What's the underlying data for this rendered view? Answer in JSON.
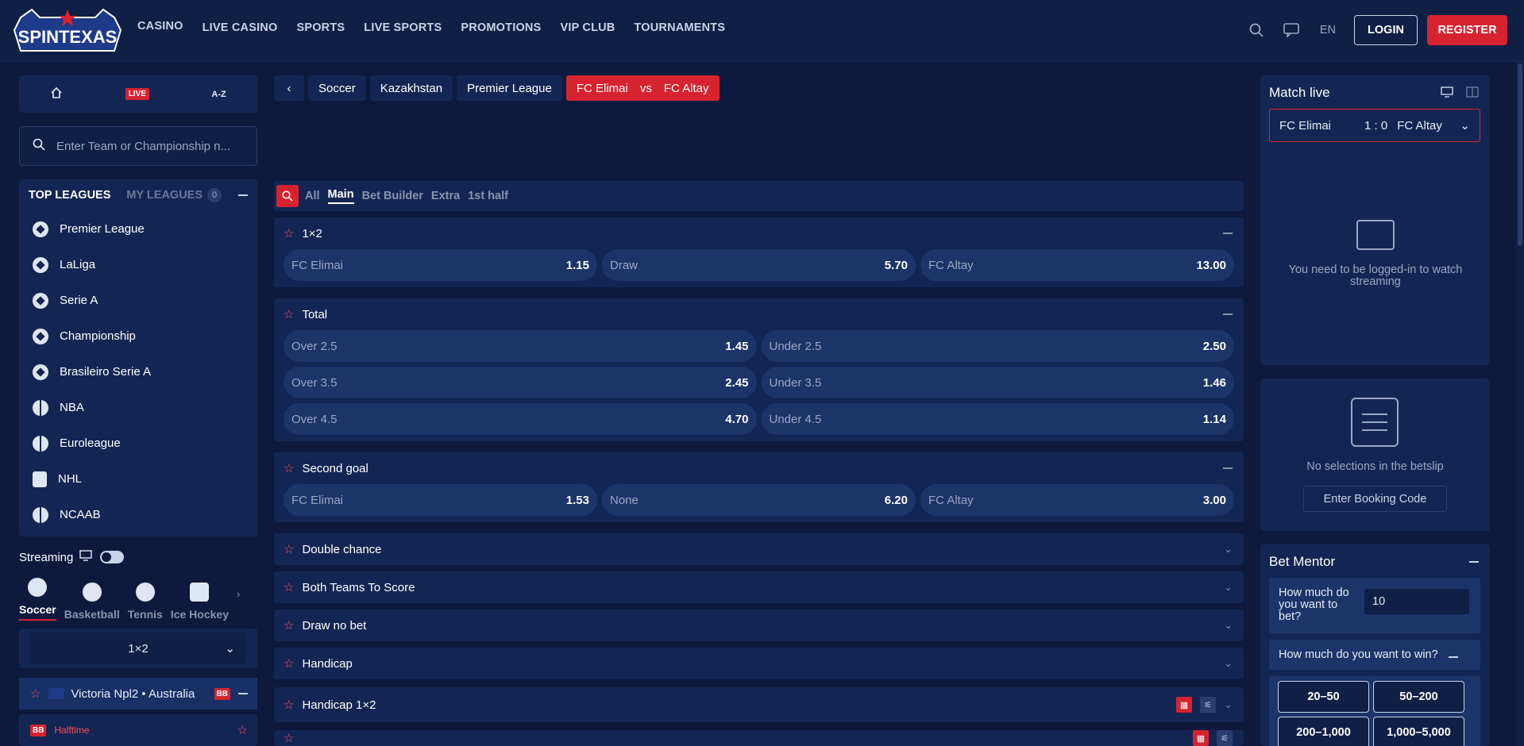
{
  "brand": {
    "logo_text": "SPINTEXAS",
    "accent": "#d6232f",
    "bg": "#0d1a3d"
  },
  "nav": [
    "CASINO",
    "LIVE CASINO",
    "SPORTS",
    "LIVE SPORTS",
    "PROMOTIONS",
    "VIP CLUB",
    "TOURNAMENTS"
  ],
  "header": {
    "lang": "EN",
    "login": "LOGIN",
    "register": "REGISTER"
  },
  "left": {
    "tabs": {
      "live": "LIVE",
      "az": "A-Z"
    },
    "search_placeholder": "Enter Team or Championship n...",
    "top_leagues": "TOP LEAGUES",
    "my_leagues": "MY LEAGUES",
    "my_leagues_count": "0",
    "leagues": [
      "Premier League",
      "LaLiga",
      "Serie A",
      "Championship",
      "Brasileiro Serie A",
      "NBA",
      "Euroleague",
      "NHL",
      "NCAAB"
    ],
    "streaming": "Streaming",
    "sports": [
      "Soccer",
      "Basketball",
      "Tennis",
      "Ice Hockey"
    ],
    "market_select": "1×2",
    "event_group": "Victoria Npl2 • Australia",
    "bb": "BB",
    "event_status": "Halftime"
  },
  "crumbs": [
    "Soccer",
    "Kazakhstan",
    "Premier League"
  ],
  "match": {
    "home": "FC Elimai",
    "vs": "vs",
    "away": "FC Altay",
    "score": "1 : 0"
  },
  "market_tabs": [
    "All",
    "Main",
    "Bet Builder",
    "Extra",
    "1st half"
  ],
  "markets": {
    "m1x2": {
      "title": "1×2",
      "odds": [
        [
          "FC Elimai",
          "1.15"
        ],
        [
          "Draw",
          "5.70"
        ],
        [
          "FC Altay",
          "13.00"
        ]
      ]
    },
    "total": {
      "title": "Total",
      "rows": [
        [
          [
            "Over 2.5",
            "1.45"
          ],
          [
            "Under 2.5",
            "2.50"
          ]
        ],
        [
          [
            "Over 3.5",
            "2.45"
          ],
          [
            "Under 3.5",
            "1.46"
          ]
        ],
        [
          [
            "Over 4.5",
            "4.70"
          ],
          [
            "Under 4.5",
            "1.14"
          ]
        ]
      ]
    },
    "second_goal": {
      "title": "Second goal",
      "odds": [
        [
          "FC Elimai",
          "1.53"
        ],
        [
          "None",
          "6.20"
        ],
        [
          "FC Altay",
          "3.00"
        ]
      ]
    },
    "collapsed": [
      "Double chance",
      "Both Teams To Score",
      "Draw no bet",
      "Handicap",
      "Handicap 1×2"
    ]
  },
  "right": {
    "match_live": "Match live",
    "stream_msg": "You need to be logged-in to watch streaming",
    "no_selections": "No selections in the betslip",
    "booking": "Enter Booking Code",
    "bet_mentor": "Bet Mentor",
    "how_much_bet": "How much do you want to bet?",
    "bet_value": "10",
    "how_much_win": "How much do you want to win?",
    "ranges": [
      "20–50",
      "50–200",
      "200–1,000",
      "1,000–5,000"
    ]
  }
}
